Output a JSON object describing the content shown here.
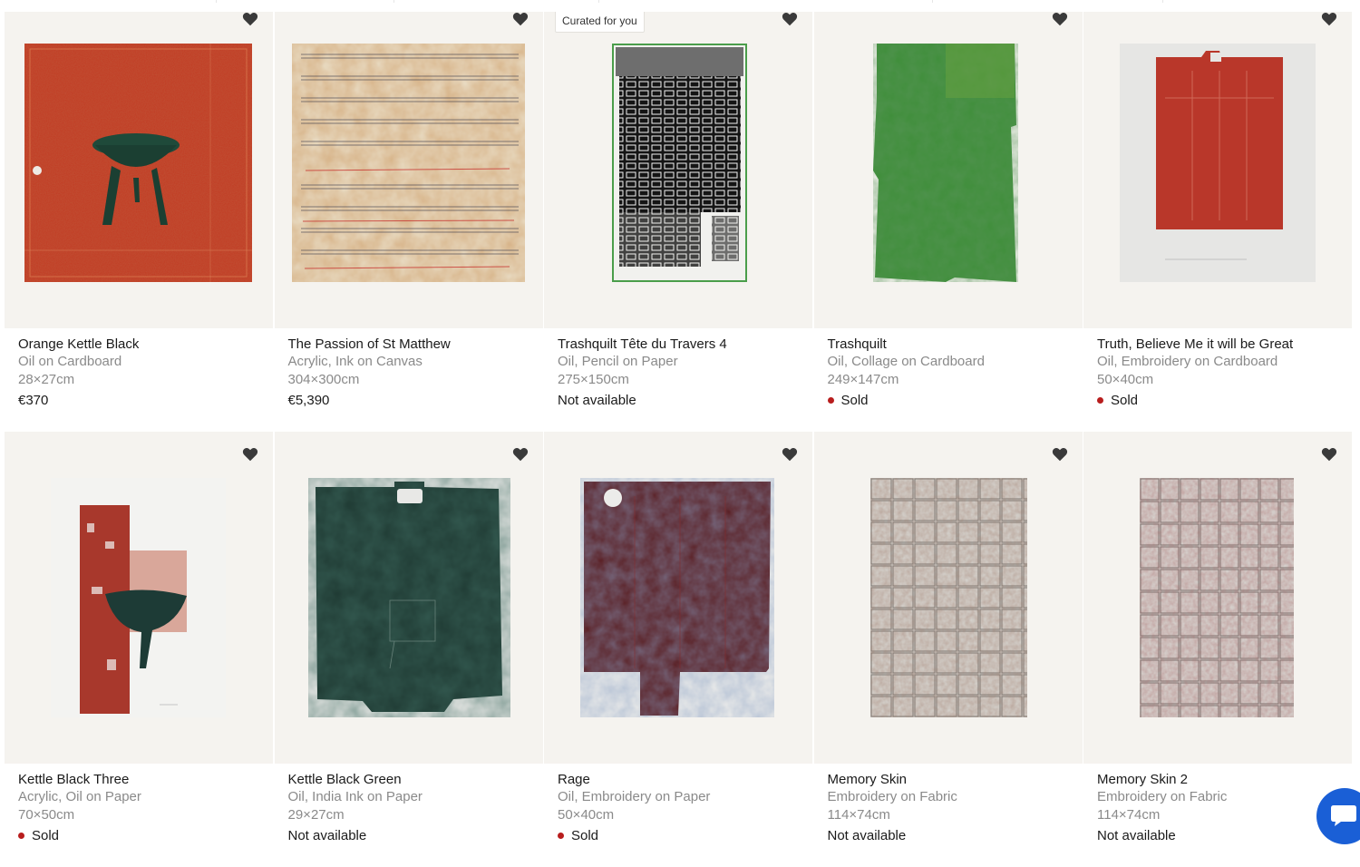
{
  "badge": "Curated for you",
  "colors": {
    "sold_dot": "#b81d1d",
    "card_bg": "#f5f3ef",
    "chat_button": "#1a5fd6"
  },
  "icons": {
    "favorite": "heart-icon",
    "chat": "chat-bubble-icon"
  },
  "row1": [
    {
      "title": "Orange Kettle Black",
      "medium": "Oil on Cardboard",
      "size": "28×27cm",
      "status": "€370"
    },
    {
      "title": "The Passion of St Matthew",
      "medium": "Acrylic, Ink on Canvas",
      "size": "304×300cm",
      "status": "€5,390"
    },
    {
      "title": "Trashquilt Tête du Travers 4",
      "medium": "Oil, Pencil on Paper",
      "size": "275×150cm",
      "status": "Not available"
    },
    {
      "title": "Trashquilt",
      "medium": "Oil, Collage on Cardboard",
      "size": "249×147cm",
      "status": "Sold"
    },
    {
      "title": "Truth, Believe Me it will be Great",
      "medium": "Oil, Embroidery on Cardboard",
      "size": "50×40cm",
      "status": "Sold"
    }
  ],
  "row2": [
    {
      "title": "Kettle Black Three",
      "medium": "Acrylic, Oil on Paper",
      "size": "70×50cm",
      "status": "Sold"
    },
    {
      "title": "Kettle Black Green",
      "medium": "Oil, India Ink on Paper",
      "size": "29×27cm",
      "status": "Not available"
    },
    {
      "title": "Rage",
      "medium": "Oil, Embroidery on Paper",
      "size": "50×40cm",
      "status": "Sold"
    },
    {
      "title": "Memory Skin",
      "medium": "Embroidery on Fabric",
      "size": "114×74cm",
      "status": "Not available"
    },
    {
      "title": "Memory Skin 2",
      "medium": "Embroidery on Fabric",
      "size": "114×74cm",
      "status": "Not available"
    }
  ]
}
